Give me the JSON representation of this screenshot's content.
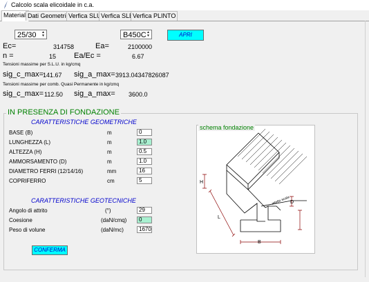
{
  "window": {
    "title": "Calcolo scala elicoidale in c.a."
  },
  "tabs": [
    {
      "label": "Materiali",
      "active": true
    },
    {
      "label": "Dati Geometrici",
      "active": false
    },
    {
      "label": "Verfica SLU",
      "active": false
    },
    {
      "label": "Verfica SLE",
      "active": false
    },
    {
      "label": "Verfica PLINTO",
      "active": false
    }
  ],
  "materials": {
    "concrete_select": "25/30",
    "steel_select": "B450C",
    "apri_button": "APRI",
    "ec_label": "Ec=",
    "ec_value": "314758",
    "ea_label": "Ea=",
    "ea_value": "2100000",
    "n_label": "n =",
    "n_value": "15",
    "eaec_label": "Ea/Ec =",
    "eaec_value": "6.67",
    "slu_title": "Tensioni massime per S.L.U. in kg/cmq",
    "slu_sigc_label": "sig_c_max=",
    "slu_sigc_value": "141.67",
    "slu_siga_label": "sig_a_max=",
    "slu_siga_value": "3913.04347826087",
    "qp_title": "Tensioni massime per comb. Quasi Permanente in kg/cmq",
    "qp_sigc_label": "sig_c_max=",
    "qp_sigc_value": "112.50",
    "qp_siga_label": "sig_a_max=",
    "qp_siga_value": "3600.0"
  },
  "foundation": {
    "group_title": "IN PRESENZA DI FONDAZIONE",
    "geom_header": "CARATTERISTICHE GEOMETRICHE",
    "geom_rows": [
      {
        "label": "BASE   (B)",
        "unit": "m",
        "value": "0",
        "highlight": false
      },
      {
        "label": "LUNGHEZZA   (L)",
        "unit": "m",
        "value": "1.0",
        "highlight": true
      },
      {
        "label": "ALTEZZA    (H)",
        "unit": "m",
        "value": "0.5",
        "highlight": false
      },
      {
        "label": "AMMORSAMENTO  (D)",
        "unit": "m",
        "value": "1.0",
        "highlight": false
      },
      {
        "label": "DIAMETRO FERRI (12/14/16)",
        "unit": "mm",
        "value": "16",
        "highlight": false
      },
      {
        "label": "COPRIFERRO",
        "unit": "cm",
        "value": "5",
        "highlight": false
      }
    ],
    "geot_header": "CARATTERISTICHE GEOTECNICHE",
    "geot_rows": [
      {
        "label": "Angolo di attrito",
        "unit": "(°)",
        "value": "29",
        "highlight": false
      },
      {
        "label": "Coesione",
        "unit": "(daN/cmq)",
        "value": "0",
        "highlight": true
      },
      {
        "label": "Peso di volune",
        "unit": "(daN/mc)",
        "value": "1670",
        "highlight": false
      }
    ],
    "confirm_button": "CONFERMA",
    "schema_title": "schema fondazione",
    "diagram_labels": {
      "L": "L",
      "H": "H",
      "D": "D",
      "B": "B",
      "stair": "attetto scala"
    }
  },
  "colors": {
    "accent_button": "#00ffff",
    "green_field": "#a8f0d0",
    "group_title": "#008000",
    "section_header": "#0000cc",
    "dimension_lines": "#8b0000"
  }
}
